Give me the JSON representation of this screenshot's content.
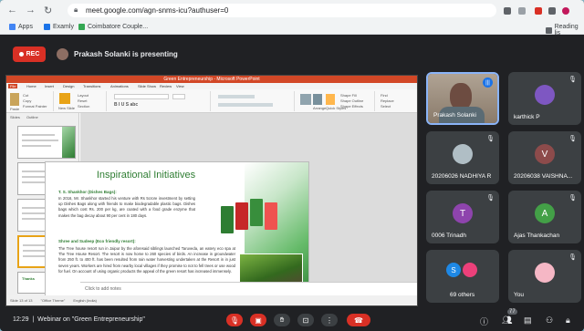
{
  "browser": {
    "url": "meet.google.com/agn-snms-icu?authuser=0",
    "bookmarks": [
      "Apps",
      "Examly",
      "Coimbatore Couple..."
    ],
    "reading_list": "Reading lis"
  },
  "meet": {
    "rec_label": "REC",
    "presenting_text": "Prakash Solanki is presenting",
    "time": "12:29",
    "meeting_title": "Webinar on \"Green Entrepreneurship\"",
    "chat_badge": "77"
  },
  "powerpoint": {
    "window_title": "Green Entrepreneurship - Microsoft PowerPoint",
    "tabs": [
      "File",
      "Home",
      "Insert",
      "Design",
      "Transitions",
      "Animations",
      "Slide Show",
      "Review",
      "View"
    ],
    "ribbon": {
      "cut": "Cut",
      "copy": "Copy",
      "paste": "Paste",
      "format_painter": "Format Painter",
      "new_slide": "New Slide",
      "layout": "Layout",
      "reset": "Reset",
      "section": "Section",
      "shape_fill": "Shape Fill",
      "shape_outline": "Shape Outline",
      "shape_effects": "Shape Effects",
      "find": "Find",
      "replace": "Replace",
      "select": "Select",
      "arrange": "Arrange",
      "quick_styles": "Quick Styles"
    },
    "thumb_panel_tabs": [
      "Slides",
      "Outline"
    ],
    "thumbnails": [
      "",
      "",
      "",
      "",
      "Thanks"
    ],
    "notes_placeholder": "Click to add notes",
    "status_slide": "Slide 13 of 13",
    "status_theme": "\"Office Theme\"",
    "status_lang": "English (India)"
  },
  "slide": {
    "title": "Inspirational Initiatives",
    "point1_heading": "T. S. Shankhor (Dishes Bags):",
    "point1_text": "In 2016, Mr. Shankhor started his venture with Rs 5crore investment by setting up Dishes Bags along with friends to make biodegradable plastic bags. Dishes bags which cost Rs. 200 per kg, are coated with a food grade enzyme that makes the bag decay about 90 per cent in 180 days.",
    "point2_heading": "Shree and Sudeep (Eco friendly resort):",
    "point2_text": "The Tree house resort run in Jaipur by the aforesaid siblings launched Taruveda, an eatery eco spa at The Tree House Resort. The resort is now home to 260 species of birds. An increase in groundwater from 250 ft. to 400 ft. has been resulted from rain water harvesting undertaken at the Resort in in just seven years. Workers are hired from nearby local villages if they promise to not to fell trees or use wood for fuel. On account of using organic products the appeal of the green resort has increased immensely."
  },
  "participants": [
    {
      "name": "Prakash Solanki",
      "type": "video",
      "speaking": true
    },
    {
      "name": "karthick P",
      "type": "photo",
      "color": "#7e57c2"
    },
    {
      "name": "20206026 NADHIYA R",
      "type": "photo",
      "color": "#b0bec5"
    },
    {
      "name": "20206038 VAISHNA...",
      "type": "letter",
      "letter": "V",
      "color": "#8d4b4b"
    },
    {
      "name": "0006 Trinadh",
      "type": "letter",
      "letter": "T",
      "color": "#8e44ad"
    },
    {
      "name": "Ajas Thankachan",
      "type": "letter",
      "letter": "A",
      "color": "#43a047"
    },
    {
      "name": "69 others",
      "type": "group",
      "letter": "S",
      "color": "#1e88e5"
    },
    {
      "name": "You",
      "type": "photo",
      "color": "#f5b7c5"
    }
  ],
  "colors": {
    "meet_bg": "#202124",
    "tile_bg": "#3c4043",
    "rec_red": "#d93025",
    "slide_green": "#2e7d32",
    "ppt_orange": "#d24726"
  }
}
